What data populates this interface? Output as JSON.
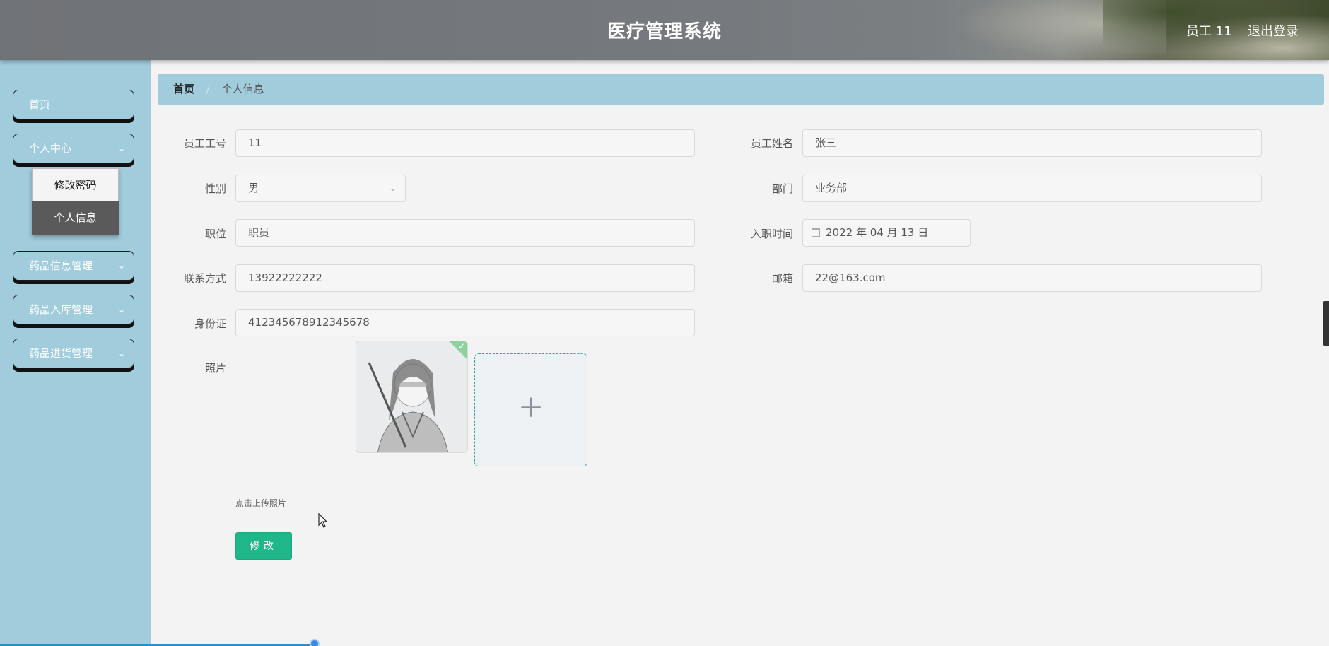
{
  "header": {
    "title": "医疗管理系统",
    "user_label": "员工 11",
    "logout_label": "退出登录"
  },
  "sidebar": {
    "items": [
      {
        "label": "首页",
        "has_arrow": false
      },
      {
        "label": "个人中心",
        "has_arrow": true,
        "expanded": true
      },
      {
        "label": "药品信息管理",
        "has_arrow": true
      },
      {
        "label": "药品入库管理",
        "has_arrow": true
      },
      {
        "label": "药品进货管理",
        "has_arrow": true
      }
    ],
    "submenu": [
      {
        "label": "修改密码",
        "active": false
      },
      {
        "label": "个人信息",
        "active": true
      }
    ]
  },
  "breadcrumb": {
    "home": "首页",
    "separator": "/",
    "current": "个人信息"
  },
  "form": {
    "employee_no": {
      "label": "员工工号",
      "value": "11"
    },
    "employee_name": {
      "label": "员工姓名",
      "value": "张三"
    },
    "gender": {
      "label": "性别",
      "value": "男"
    },
    "department": {
      "label": "部门",
      "value": "业务部"
    },
    "position": {
      "label": "职位",
      "value": "职员"
    },
    "hire_date": {
      "label": "入职时间",
      "value": "2022 年 04 月 13 日"
    },
    "phone": {
      "label": "联系方式",
      "value": "13922222222"
    },
    "email": {
      "label": "邮箱",
      "value": "22@163.com"
    },
    "id_card": {
      "label": "身份证",
      "value": "412345678912345678"
    },
    "photo": {
      "label": "照片",
      "upload_tip": "点击上传照片"
    },
    "submit_label": "修改"
  },
  "colors": {
    "sidebar_bg": "#a1ccdc",
    "accent_green": "#1fb78a",
    "upload_border": "#2ea6a0"
  }
}
